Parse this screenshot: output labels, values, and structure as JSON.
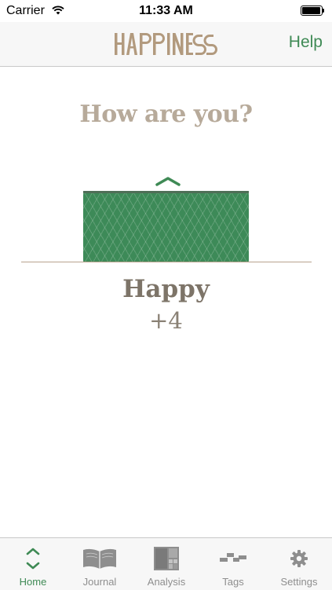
{
  "status_bar": {
    "carrier": "Carrier",
    "time": "11:33 AM",
    "battery_level": 1.0
  },
  "nav": {
    "logo_text": "HAPPINESS",
    "help_label": "Help"
  },
  "main": {
    "question": "How are you?",
    "mood_label": "Happy",
    "mood_score": "+4"
  },
  "tabs": [
    {
      "label": "Home",
      "icon": "home-arrows-icon",
      "active": true
    },
    {
      "label": "Journal",
      "icon": "book-icon",
      "active": false
    },
    {
      "label": "Analysis",
      "icon": "grid-chart-icon",
      "active": false
    },
    {
      "label": "Tags",
      "icon": "tags-steps-icon",
      "active": false
    },
    {
      "label": "Settings",
      "icon": "gear-icon",
      "active": false
    }
  ],
  "colors": {
    "accent": "#3f8a55",
    "mood_bar": "#3d8a58",
    "question_text": "#b7aa9a",
    "logo": "#b29a7e"
  }
}
